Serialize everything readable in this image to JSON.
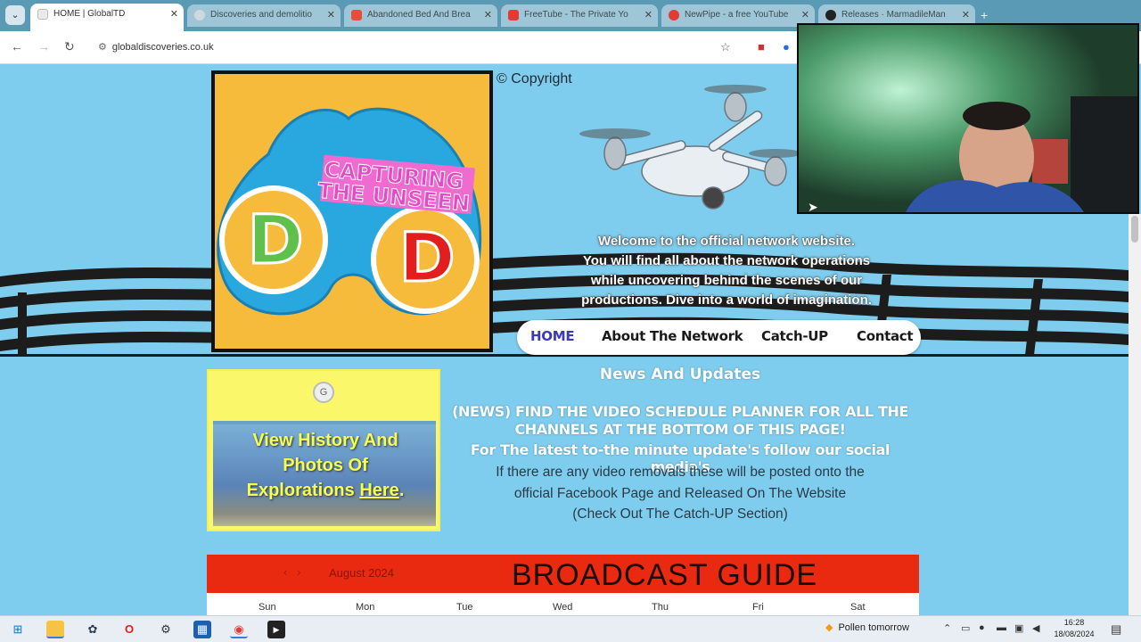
{
  "browser": {
    "tabs": [
      {
        "title": "HOME | GlobalTD",
        "color": "#f2f2f2",
        "active": true
      },
      {
        "title": "Discoveries and demolitio",
        "color": "#cfd8dc",
        "active": false
      },
      {
        "title": "Abandoned Bed And Brea",
        "color": "#e74c3c",
        "active": false
      },
      {
        "title": "FreeTube - The Private Yo",
        "color": "#e53935",
        "active": false
      },
      {
        "title": "NewPipe - a free YouTube",
        "color": "#e53935",
        "active": false
      },
      {
        "title": "Releases · MarmadileMan",
        "color": "#222222",
        "active": false
      }
    ],
    "url": "globaldiscoveries.co.uk"
  },
  "hero": {
    "copyright": "© Copyright",
    "logo_tagline_1": "CAPTURING",
    "logo_tagline_2": "THE UNSEEN",
    "logo_letter_left": "D",
    "logo_letter_right": "D",
    "welcome_lines": [
      "Welcome to the official network website.",
      "You will find all about the network operations",
      "while uncovering behind the scenes of our",
      "productions. Dive into a world of imagination."
    ]
  },
  "nav": {
    "items": [
      "HOME",
      "About The Network",
      "Catch-UP",
      "Contact"
    ],
    "active": "HOME"
  },
  "history_card": {
    "line1": "View History And",
    "line2": "Photos Of",
    "line3_prefix": "Explorations ",
    "link": "Here",
    "suffix": "."
  },
  "news": {
    "heading": "News And Updates",
    "caps_line1": "(NEWS) FIND THE VIDEO SCHEDULE PLANNER FOR ALL THE",
    "caps_line2": "CHANNELS AT THE BOTTOM OF THIS PAGE!",
    "social": "For The latest to-the minute update's follow our social media's",
    "body_line1": "If there are any video removals these will be posted onto the",
    "body_line2": "official Facebook Page and Released On The Website",
    "body_line3": "(Check Out The Catch-UP Section)"
  },
  "guide": {
    "title": "BROADCAST GUIDE",
    "month": "August 2024",
    "days": [
      "Sun",
      "Mon",
      "Tue",
      "Wed",
      "Thu",
      "Fri",
      "Sat"
    ]
  },
  "taskbar": {
    "weather": "Pollen tomorrow",
    "time": "16:28",
    "date": "18/08/2024"
  },
  "colors": {
    "page_bg": "#7fcdee",
    "logo_bg": "#f7bb3c",
    "guide_red": "#ea2a10",
    "nav_active": "#3b3ab8",
    "history_yellow": "#fbf76a"
  }
}
